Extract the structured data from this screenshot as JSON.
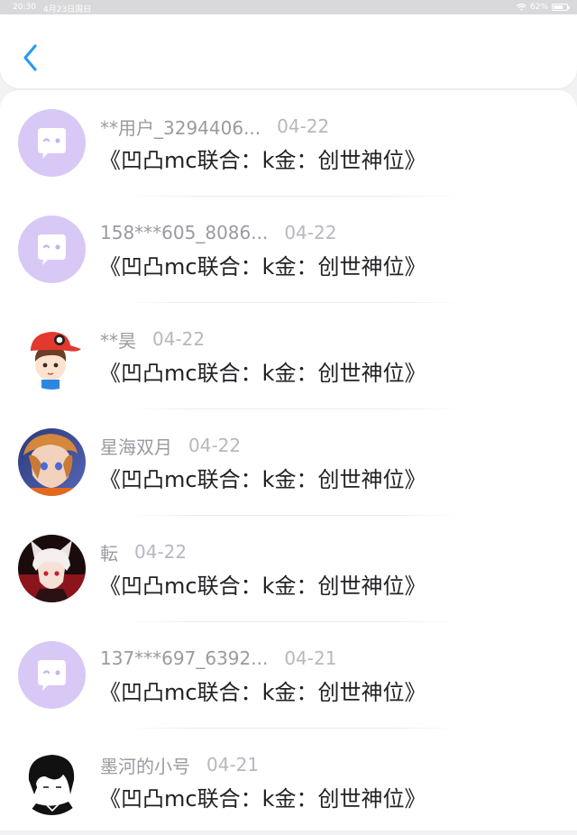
{
  "status_bar": {
    "time": "20:30",
    "date": "4月23日周日",
    "battery": "62%",
    "wifi_icon": "wifi-icon",
    "battery_icon": "battery-icon"
  },
  "header": {
    "back_icon": "chevron-left-icon",
    "accent_color": "#2a9af0"
  },
  "items": [
    {
      "user": "**用户_3294406...",
      "date": "04-22",
      "message": "《凹凸mc联合：k金：创世神位》",
      "avatar": "default-chat-avatar"
    },
    {
      "user": "158***605_8086...",
      "date": "04-22",
      "message": "《凹凸mc联合：k金：创世神位》",
      "avatar": "default-chat-avatar"
    },
    {
      "user": "**昊",
      "date": "04-22",
      "message": "《凹凸mc联合：k金：创世神位》",
      "avatar": "cartoon-boy-red-cap-avatar"
    },
    {
      "user": "星海双月",
      "date": "04-22",
      "message": "《凹凸mc联合：k金：创世神位》",
      "avatar": "anime-character-avatar"
    },
    {
      "user": "転",
      "date": "04-22",
      "message": "《凹凸mc联合：k金：创世神位》",
      "avatar": "anime-fox-ears-avatar"
    },
    {
      "user": "137***697_6392...",
      "date": "04-21",
      "message": "《凹凸mc联合：k金：创世神位》",
      "avatar": "default-chat-avatar"
    },
    {
      "user": "墨河的小号",
      "date": "04-21",
      "message": "《凹凸mc联合：k金：创世神位》",
      "avatar": "black-hair-sketch-avatar"
    }
  ],
  "colors": {
    "default_avatar_bg": "#d8c8f6",
    "username": "#9a9aa2",
    "date": "#b7b7bf",
    "message": "#222226"
  }
}
